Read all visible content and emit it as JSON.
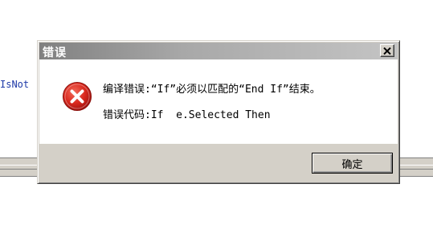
{
  "background": {
    "code_fragment": "IsNot"
  },
  "dialog": {
    "title": "错误",
    "close_icon": "close-x-icon",
    "icon": "error-icon",
    "message_line1": "编译错误:“If”必须以匹配的“End If”结束。",
    "message_line2": "错误代码:If  e.Selected Then",
    "ok_label": "确定"
  },
  "colors": {
    "error_red": "#d9281e",
    "title_text": "#ffffff",
    "window_face": "#d4d0c8"
  }
}
